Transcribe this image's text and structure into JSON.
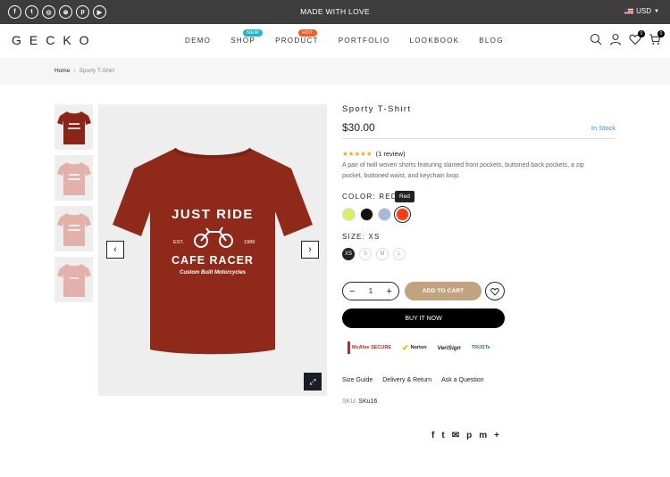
{
  "topbar": {
    "socials": [
      "f",
      "t",
      "ig",
      "dr",
      "p",
      "yt"
    ],
    "message": "MADE WITH LOVE",
    "currency": "USD"
  },
  "header": {
    "logo": "GECKO",
    "nav": [
      {
        "label": "DEMO",
        "badge": "",
        "badge_color": ""
      },
      {
        "label": "SHOP",
        "badge": "NEW",
        "badge_color": "#1fb4c9"
      },
      {
        "label": "PRODUCT",
        "badge": "HOT",
        "badge_color": "#ff5722"
      },
      {
        "label": "PORTFOLIO",
        "badge": "",
        "badge_color": ""
      },
      {
        "label": "LOOKBOOK",
        "badge": "",
        "badge_color": ""
      },
      {
        "label": "BLOG",
        "badge": "",
        "badge_color": ""
      }
    ],
    "wishlist_count": "0",
    "cart_count": "0"
  },
  "breadcrumb": {
    "home": "Home",
    "sep": "›",
    "current": "Sporty T-Shirt"
  },
  "product": {
    "title": "Sporty T-Shirt",
    "price": "$30.00",
    "stock": "In Stock",
    "stars": "★★★★★",
    "reviews": "(1 review)",
    "description": "A pair of twill woven shorts featuring slanted front pockets, buttoned back pockets, a zip pocket, buttoned waist, and keychain loop.",
    "color_label": "COLOR: RED",
    "tooltip": "Red",
    "colors": [
      "#d4ef6a",
      "#111111",
      "#a9b8d8",
      "#ff3d12"
    ],
    "size_label": "SIZE: XS",
    "sizes": [
      "XS",
      "S",
      "M",
      "L"
    ],
    "quantity": "1",
    "add_to_cart": "ADD TO CART",
    "buy_now": "BUY IT NOW",
    "trust_badges": [
      "McAfee SECURE",
      "Norton",
      "VeriSign",
      "TRUSTe"
    ],
    "links": [
      "Size Guide",
      "Delivery & Return",
      "Ask a Question"
    ],
    "sku_label": "SKU:",
    "sku_value": "SKu16",
    "shirt_text": {
      "line1": "JUST RIDE",
      "est": "EST.",
      "year": "1989",
      "line2": "CAFE RACER",
      "line3": "Custom Built Motorcycles"
    }
  },
  "share_icons": [
    "f",
    "t",
    "✉",
    "p",
    "m",
    "+"
  ]
}
